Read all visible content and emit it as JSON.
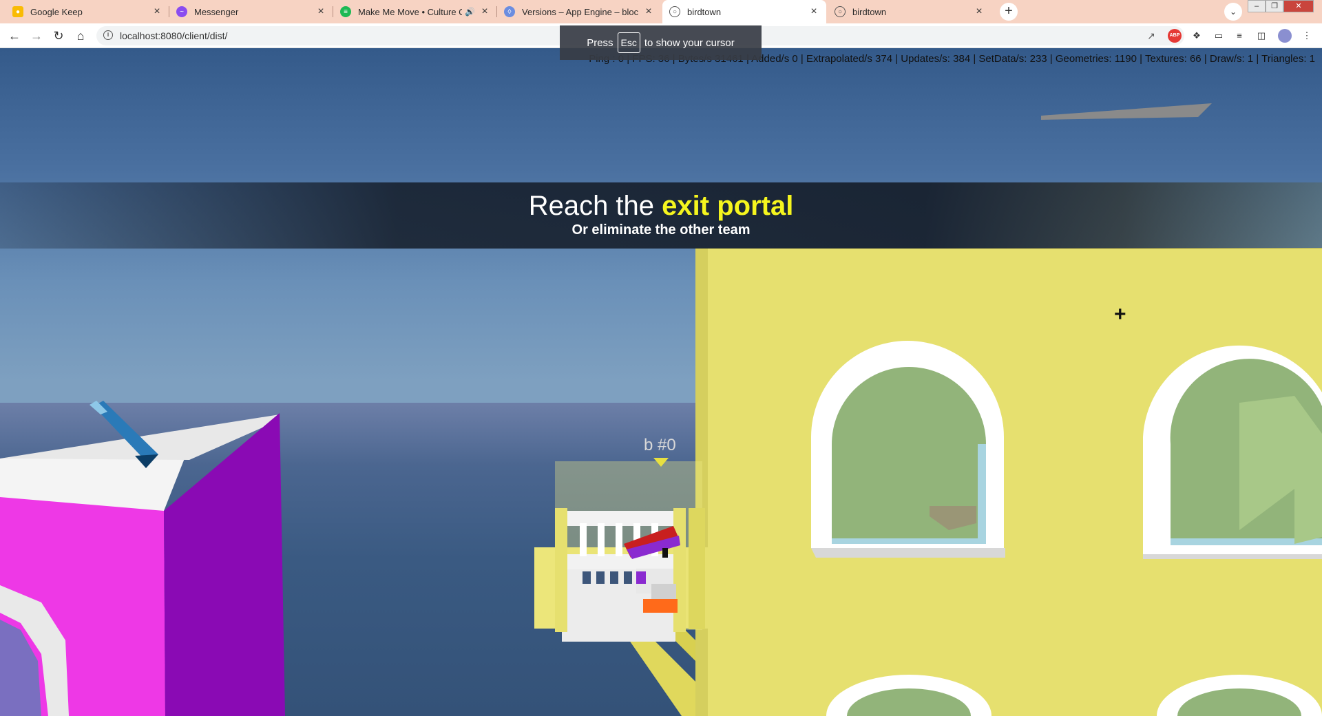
{
  "browser": {
    "tabs": [
      {
        "title": "Google Keep",
        "favicon": "keep-icon",
        "color": "#f9bb04",
        "active": false
      },
      {
        "title": "Messenger",
        "favicon": "messenger-icon",
        "color": "#8a4cf0",
        "active": false
      },
      {
        "title": "Make Me Move • Culture Co",
        "favicon": "spotify-icon",
        "color": "#1db954",
        "active": false,
        "audio": true
      },
      {
        "title": "Versions – App Engine – blockdu",
        "favicon": "appengine-icon",
        "color": "#6b8de0",
        "active": false
      },
      {
        "title": "birdtown",
        "favicon": "globe-icon",
        "color": "#555555",
        "active": true
      },
      {
        "title": "birdtown",
        "favicon": "globe-icon",
        "color": "#555555",
        "active": false
      }
    ],
    "new_tab_label": "+",
    "url": "localhost:8080/client/dist/"
  },
  "pointer_hint": {
    "prefix": "Press",
    "key": "Esc",
    "suffix": "to show your cursor"
  },
  "stats_text": "Ping : 0 | FPS: 36 | Bytes/s 31461 | Added/s 0 | Extrapolated/s 374 | Updates/s: 384 | SetData/s: 233 | Geometries: 1190 | Textures: 66 | Draw/s: 1 | Triangles: 1",
  "objective": {
    "prefix": "Reach the",
    "highlight": "exit portal",
    "subtitle": "Or eliminate the other team"
  },
  "player": {
    "tag": "b #0"
  },
  "crosshair": "+",
  "colors": {
    "highlight": "#f5f51e",
    "building_yellow": "#e6e06f",
    "building_magenta": "#ee38e6",
    "building_purple": "#8a0ab4",
    "window_glass": "#8fb57a"
  }
}
